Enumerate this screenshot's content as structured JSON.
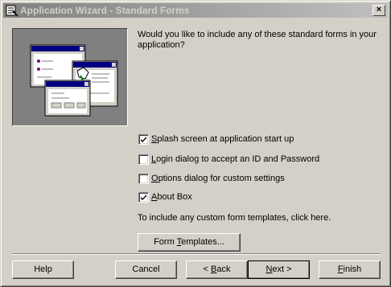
{
  "window": {
    "title": "Application Wizard - Standard Forms",
    "close_glyph": "×"
  },
  "main": {
    "question": "Would you like to include any of these standard forms in your application?",
    "options": [
      {
        "label": "Splash screen at application start up",
        "mnemonic": "S",
        "checked": true
      },
      {
        "label": "Login dialog to accept an ID and Password",
        "mnemonic": "L",
        "checked": false
      },
      {
        "label": "Options dialog for custom settings",
        "mnemonic": "O",
        "checked": false
      },
      {
        "label": "About Box",
        "mnemonic": "A",
        "checked": true
      }
    ],
    "hint": "To include any custom form templates, click here.",
    "form_templates_button": "Form Templates..."
  },
  "footer": {
    "help": "Help",
    "cancel": "Cancel",
    "back": "< Back",
    "next": "Next >",
    "finish": "Finish"
  },
  "colors": {
    "face": "#d4d0c8",
    "titlebar_inactive_start": "#808080",
    "titlebar_inactive_end": "#c0c0c0",
    "illustration_bg": "#808080",
    "mini_window_title": "#000080"
  }
}
